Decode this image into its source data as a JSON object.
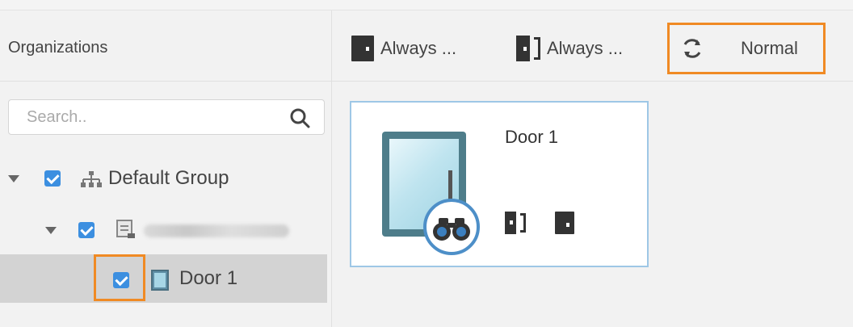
{
  "organizations": {
    "title": "Organizations",
    "search_placeholder": "Search.."
  },
  "tree": {
    "group": {
      "label": "Default Group",
      "checked": true,
      "expanded": true
    },
    "device": {
      "label": "",
      "checked": true,
      "expanded": true,
      "label_obscured": true
    },
    "door": {
      "label": "Door 1",
      "checked": true,
      "selected": true
    }
  },
  "toolbar": {
    "always_closed_label": "Always ...",
    "always_open_label": "Always ...",
    "normal_label": "Normal"
  },
  "card": {
    "title": "Door 1"
  },
  "colors": {
    "highlight": "#f08a24",
    "checkbox": "#3c8fe0",
    "card_border": "#9ec7e6",
    "selected_row": "#d3d3d3"
  },
  "icons": [
    "search-icon",
    "org-tree-icon",
    "device-icon",
    "door-icon",
    "door-closed-icon",
    "door-open-icon",
    "refresh-icon",
    "binoculars-icon"
  ]
}
